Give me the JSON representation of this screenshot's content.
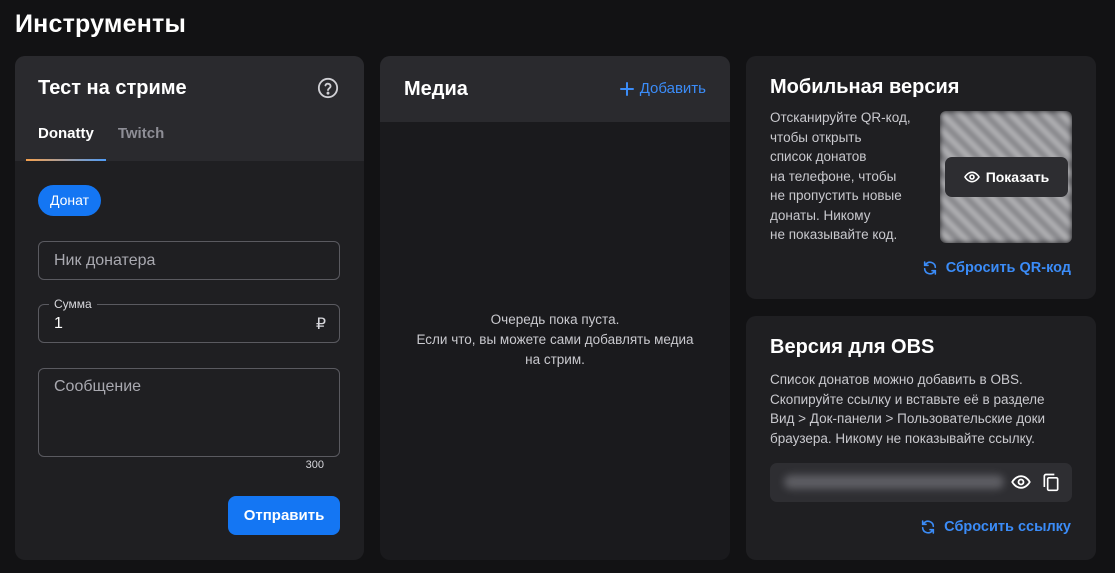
{
  "page": {
    "title": "Инструменты"
  },
  "test_card": {
    "title": "Тест на стриме",
    "tabs": [
      {
        "label": "Donatty",
        "active": true
      },
      {
        "label": "Twitch",
        "active": false
      }
    ],
    "chip": "Донат",
    "nick_placeholder": "Ник донатера",
    "sum_label": "Сумма",
    "sum_value": "1",
    "currency": "₽",
    "message_placeholder": "Сообщение",
    "char_limit": "300",
    "submit_label": "Отправить"
  },
  "media_card": {
    "title": "Медиа",
    "add_label": "Добавить",
    "empty_lines": [
      "Очередь пока пуста.",
      "Если что, вы можете сами добавлять медиа",
      "на стрим."
    ]
  },
  "mobile_card": {
    "title": "Мобильная версия",
    "description_lines": [
      "Отсканируйте QR-код,",
      "чтобы открыть",
      "список донатов",
      "на телефоне, чтобы",
      "не пропустить новые",
      "донаты. Никому",
      "не показывайте код."
    ],
    "show_label": "Показать",
    "reset_label": "Сбросить QR-код"
  },
  "obs_card": {
    "title": "Версия для OBS",
    "description_lines": [
      "Список донатов можно добавить в OBS.",
      "Скопируйте ссылку и вставьте её в разделе",
      "Вид > Док-панели > Пользовательские доки",
      "браузера. Никому не показывайте ссылку."
    ],
    "reset_label": "Сбросить ссылку"
  },
  "colors": {
    "background": "#121214",
    "card": "#1f1f22",
    "card_header": "#2a2a2e",
    "accent": "#1476f3",
    "link": "#3b8cf8",
    "tab_gradient_start": "#f6a04d",
    "tab_gradient_end": "#4f9cf7"
  },
  "icons": {
    "help": "help-circle-icon",
    "plus": "plus-icon",
    "eye": "eye-icon",
    "refresh": "refresh-icon",
    "copy": "copy-icon"
  }
}
